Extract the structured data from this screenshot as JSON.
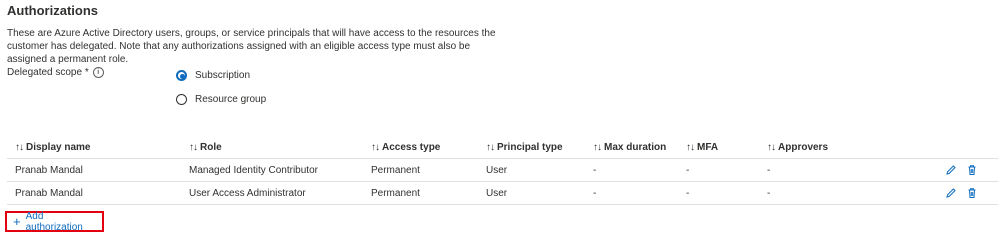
{
  "section": {
    "title": "Authorizations",
    "description": "These are Azure Active Directory users, groups, or service principals that will have access to the resources the customer has delegated. Note that any authorizations assigned with an eligible access type must also be assigned a permanent role."
  },
  "scope": {
    "label": "Delegated scope *",
    "info_icon": "info-icon",
    "options": [
      {
        "label": "Subscription",
        "selected": true
      },
      {
        "label": "Resource group",
        "selected": false
      }
    ]
  },
  "table": {
    "sort_glyph": "↑↓",
    "columns": [
      "Display name",
      "Role",
      "Access type",
      "Principal type",
      "Max duration",
      "MFA",
      "Approvers"
    ],
    "rows": [
      {
        "display_name": "Pranab Mandal",
        "role": "Managed Identity Contributor",
        "access_type": "Permanent",
        "principal_type": "User",
        "max_duration": "-",
        "mfa": "-",
        "approvers": "-"
      },
      {
        "display_name": "Pranab Mandal",
        "role": "User Access Administrator",
        "access_type": "Permanent",
        "principal_type": "User",
        "max_duration": "-",
        "mfa": "-",
        "approvers": "-"
      }
    ],
    "row_actions": [
      "edit-pencil-icon",
      "delete-trash-icon"
    ]
  },
  "add_button": {
    "label": "Add authorization",
    "icon": "plus-icon"
  },
  "colors": {
    "accent": "#0f6cbd",
    "highlight_border": "#e3000f",
    "divider": "#e1dfdd"
  }
}
